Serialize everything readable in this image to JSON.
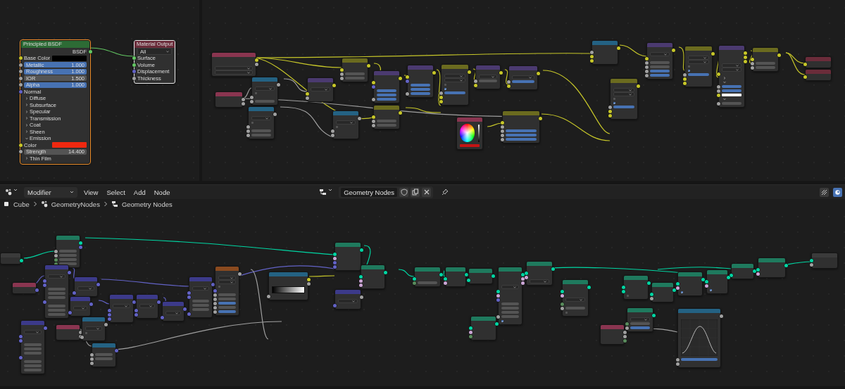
{
  "shader_editor": {
    "nodes": [
      {
        "title": "Principled BSDF",
        "color": "#2d6b35",
        "selected": true,
        "active": false,
        "rows": [
          {
            "kind": "out",
            "label": "BSDF",
            "socket": {
              "color": "#63c763"
            }
          },
          {
            "kind": "color",
            "label": "Base Color",
            "color": "#000000",
            "socket": {
              "color": "#c7c729"
            }
          },
          {
            "kind": "field",
            "label": "Metallic",
            "value": "1.000",
            "filled": true,
            "socket": {
              "color": "#a1a1a1"
            }
          },
          {
            "kind": "field",
            "label": "Roughness",
            "value": "1.000",
            "filled": true,
            "socket": {
              "color": "#a1a1a1"
            }
          },
          {
            "kind": "field",
            "label": "IOR",
            "value": "1.500",
            "filled": false,
            "socket": {
              "color": "#a1a1a1"
            }
          },
          {
            "kind": "field",
            "label": "Alpha",
            "value": "1.000",
            "filled": true,
            "socket": {
              "color": "#a1a1a1"
            }
          },
          {
            "kind": "in",
            "label": "Normal",
            "socket": {
              "color": "#6363c7"
            }
          },
          {
            "kind": "panel",
            "label": "Diffuse",
            "expanded": false
          },
          {
            "kind": "panel",
            "label": "Subsurface",
            "expanded": false
          },
          {
            "kind": "panel",
            "label": "Specular",
            "expanded": false
          },
          {
            "kind": "panel",
            "label": "Transmission",
            "expanded": false
          },
          {
            "kind": "panel",
            "label": "Coat",
            "expanded": false
          },
          {
            "kind": "panel",
            "label": "Sheen",
            "expanded": false
          },
          {
            "kind": "panel",
            "label": "Emission",
            "expanded": true
          },
          {
            "kind": "color",
            "label": "Color",
            "color": "#f02810",
            "socket": {
              "color": "#c7c729"
            }
          },
          {
            "kind": "field",
            "label": "Strength",
            "value": "14.400",
            "filled": false,
            "socket": {
              "color": "#a1a1a1"
            }
          },
          {
            "kind": "panel",
            "label": "Thin Film",
            "expanded": false
          }
        ]
      },
      {
        "title": "Material Output",
        "color": "#6b2c3a",
        "selected": false,
        "active": true,
        "rows": [
          {
            "kind": "dropdown",
            "value": "All"
          },
          {
            "kind": "in",
            "label": "Surface",
            "socket": {
              "color": "#63c763"
            }
          },
          {
            "kind": "in",
            "label": "Volume",
            "socket": {
              "color": "#63c763"
            }
          },
          {
            "kind": "in",
            "label": "Displacement",
            "socket": {
              "color": "#6363c7"
            }
          },
          {
            "kind": "in",
            "label": "Thickness",
            "socket": {
              "color": "#a1a1a1"
            }
          }
        ]
      }
    ]
  },
  "compositor": {
    "nodes": [
      {
        "color": "#8a3550",
        "rows": [
          {
            "kind": "out",
            "socket": {
              "color": "#c7c729"
            }
          },
          {
            "kind": "out",
            "socket": {
              "color": "#a1a1a1"
            }
          },
          {
            "kind": "dropdown"
          },
          {
            "kind": "dropdown"
          }
        ]
      },
      {
        "color": "#8a3550",
        "rows": [
          {
            "kind": "out",
            "socket": {
              "color": "#a1a1a1"
            }
          },
          {
            "kind": "out",
            "socket": {
              "color": "#a1a1a1"
            }
          }
        ]
      },
      {
        "color": "#246283",
        "rows": [
          {
            "kind": "out",
            "socket": {
              "color": "#a1a1a1"
            }
          },
          {
            "kind": "dropdown"
          },
          {
            "kind": "check",
            "checked": false
          },
          {
            "kind": "in",
            "socket": {
              "color": "#a1a1a1"
            }
          },
          {
            "kind": "field",
            "filled": false,
            "socket": {
              "color": "#a1a1a1"
            }
          }
        ]
      },
      {
        "color": "#246283",
        "rows": [
          {
            "kind": "out",
            "socket": {
              "color": "#a1a1a1"
            }
          },
          {
            "kind": "dropdown"
          },
          {
            "kind": "check",
            "checked": false
          },
          {
            "kind": "in",
            "socket": {
              "color": "#a1a1a1"
            }
          },
          {
            "kind": "field",
            "filled": false,
            "socket": {
              "color": "#a1a1a1"
            }
          },
          {
            "kind": "field",
            "filled": false,
            "socket": {
              "color": "#a1a1a1"
            }
          }
        ]
      },
      {
        "color": "#4b3a70",
        "rows": [
          {
            "kind": "out",
            "socket": {
              "color": "#c7c729"
            }
          },
          {
            "kind": "dropdown"
          },
          {
            "kind": "in",
            "socket": {
              "color": "#c7c729"
            }
          },
          {
            "kind": "in",
            "socket": {
              "color": "#a1a1a1"
            }
          }
        ]
      },
      {
        "color": "#6b6b1f",
        "rows": [
          {
            "kind": "out",
            "socket": {
              "color": "#c7c729"
            }
          },
          {
            "kind": "in",
            "socket": {
              "color": "#c7c729"
            }
          },
          {
            "kind": "field",
            "filled": false,
            "socket": {
              "color": "#a1a1a1"
            }
          },
          {
            "kind": "field",
            "filled": false,
            "socket": {
              "color": "#a1a1a1"
            }
          }
        ]
      },
      {
        "color": "#4b3a70",
        "rows": [
          {
            "kind": "out",
            "socket": {
              "color": "#c7c729"
            }
          },
          {
            "kind": "in",
            "socket": {
              "color": "#c7c729"
            }
          },
          {
            "kind": "in",
            "socket": {
              "color": "#6363c7"
            }
          },
          {
            "kind": "field",
            "filled": true
          },
          {
            "kind": "field",
            "filled": true
          },
          {
            "kind": "field",
            "filled": true,
            "socket": {
              "color": "#a1a1a1"
            }
          }
        ]
      },
      {
        "color": "#4b3a70",
        "rows": [
          {
            "kind": "out",
            "socket": {
              "color": "#c7c729"
            }
          },
          {
            "kind": "in",
            "socket": {
              "color": "#c7c729"
            }
          },
          {
            "kind": "in",
            "socket": {
              "color": "#6363c7"
            }
          },
          {
            "kind": "field",
            "filled": true
          },
          {
            "kind": "field",
            "filled": true
          },
          {
            "kind": "field",
            "filled": true,
            "socket": {
              "color": "#a1a1a1"
            }
          }
        ]
      },
      {
        "color": "#6b6b1f",
        "rows": [
          {
            "kind": "out",
            "socket": {
              "color": "#c7c729"
            }
          },
          {
            "kind": "dropdown"
          },
          {
            "kind": "dropdown"
          },
          {
            "kind": "check",
            "checked": false
          },
          {
            "kind": "check",
            "checked": true
          },
          {
            "kind": "field",
            "filled": true,
            "socket": {
              "color": "#a1a1a1"
            }
          },
          {
            "kind": "in",
            "socket": {
              "color": "#c7c729"
            }
          },
          {
            "kind": "in",
            "socket": {
              "color": "#c7c729"
            }
          }
        ]
      },
      {
        "color": "#4b3a70",
        "rows": [
          {
            "kind": "out",
            "socket": {
              "color": "#c7c729"
            }
          },
          {
            "kind": "dropdown"
          },
          {
            "kind": "field",
            "filled": false,
            "socket": {
              "color": "#a1a1a1"
            }
          },
          {
            "kind": "in",
            "socket": {
              "color": "#c7c729"
            }
          }
        ]
      },
      {
        "color": "#4b3a70",
        "rows": [
          {
            "kind": "out",
            "socket": {
              "color": "#c7c729"
            }
          },
          {
            "kind": "dropdown"
          },
          {
            "kind": "field",
            "filled": true,
            "socket": {
              "color": "#a1a1a1"
            }
          },
          {
            "kind": "in",
            "socket": {
              "color": "#c7c729"
            }
          }
        ]
      },
      {
        "color": "#246283",
        "rows": [
          {
            "kind": "out",
            "socket": {
              "color": "#a1a1a1"
            }
          },
          {
            "kind": "dropdown"
          },
          {
            "kind": "check",
            "checked": false
          },
          {
            "kind": "in",
            "socket": {
              "color": "#a1a1a1"
            }
          },
          {
            "kind": "in",
            "socket": {
              "color": "#a1a1a1"
            }
          }
        ]
      },
      {
        "color": "#6b6b1f",
        "rows": [
          {
            "kind": "out",
            "socket": {
              "color": "#c7c729"
            }
          },
          {
            "kind": "in",
            "socket": {
              "color": "#c7c729"
            }
          },
          {
            "kind": "field",
            "filled": false,
            "socket": {
              "color": "#a1a1a1"
            }
          },
          {
            "kind": "field",
            "filled": false,
            "socket": {
              "color": "#a1a1a1"
            }
          }
        ]
      },
      {
        "color": "#8a3550",
        "rows": [
          {
            "kind": "wheel"
          },
          {
            "kind": "color",
            "color": "#c41414"
          }
        ]
      },
      {
        "color": "#6b6b1f",
        "rows": [
          {
            "kind": "out",
            "socket": {
              "color": "#c7c729"
            }
          },
          {
            "kind": "in",
            "socket": {
              "color": "#c7c729"
            }
          },
          {
            "kind": "in",
            "socket": {
              "color": "#a1a1a1"
            }
          },
          {
            "kind": "field",
            "filled": true,
            "socket": {
              "color": "#a1a1a1"
            }
          },
          {
            "kind": "field",
            "filled": true,
            "socket": {
              "color": "#a1a1a1"
            }
          },
          {
            "kind": "field",
            "filled": true,
            "socket": {
              "color": "#a1a1a1"
            }
          }
        ]
      },
      {
        "color": "#246283",
        "rows": [
          {
            "kind": "out",
            "socket": {
              "color": "#c7c729"
            }
          },
          {
            "kind": "in",
            "socket": {
              "color": "#a1a1a1"
            }
          },
          {
            "kind": "in",
            "socket": {
              "color": "#c7c729"
            }
          },
          {
            "kind": "in",
            "socket": {
              "color": "#c7c729"
            }
          }
        ]
      },
      {
        "color": "#6b6b1f",
        "rows": [
          {
            "kind": "out",
            "socket": {
              "color": "#c7c729"
            }
          },
          {
            "kind": "dropdown"
          },
          {
            "kind": "dropdown"
          },
          {
            "kind": "check",
            "checked": false
          },
          {
            "kind": "check",
            "checked": true
          },
          {
            "kind": "field",
            "filled": true,
            "socket": {
              "color": "#a1a1a1"
            }
          },
          {
            "kind": "in",
            "socket": {
              "color": "#c7c729"
            }
          },
          {
            "kind": "in",
            "socket": {
              "color": "#c7c729"
            }
          }
        ]
      },
      {
        "color": "#4b3a70",
        "rows": [
          {
            "kind": "out",
            "socket": {
              "color": "#c7c729"
            }
          },
          {
            "kind": "dropdown"
          },
          {
            "kind": "in",
            "socket": {
              "color": "#c7c729"
            }
          },
          {
            "kind": "field",
            "filled": false,
            "socket": {
              "color": "#a1a1a1"
            }
          },
          {
            "kind": "field",
            "filled": false,
            "socket": {
              "color": "#a1a1a1"
            }
          },
          {
            "kind": "field",
            "filled": true,
            "socket": {
              "color": "#a1a1a1"
            }
          },
          {
            "kind": "field",
            "filled": true,
            "socket": {
              "color": "#a1a1a1"
            }
          }
        ]
      },
      {
        "color": "#6b6b1f",
        "rows": [
          {
            "kind": "out",
            "socket": {
              "color": "#c7c729"
            }
          },
          {
            "kind": "dropdown"
          },
          {
            "kind": "dropdown"
          },
          {
            "kind": "check",
            "checked": false
          },
          {
            "kind": "check",
            "checked": true
          },
          {
            "kind": "field",
            "filled": true,
            "socket": {
              "color": "#a1a1a1"
            }
          },
          {
            "kind": "in",
            "socket": {
              "color": "#c7c729"
            }
          },
          {
            "kind": "in",
            "socket": {
              "color": "#c7c729"
            }
          }
        ]
      },
      {
        "color": "#4b3a70",
        "rows": [
          {
            "kind": "out",
            "socket": {
              "color": "#c7c729"
            }
          },
          {
            "kind": "out",
            "socket": {
              "color": "#c7c729"
            }
          },
          {
            "kind": "out",
            "socket": {
              "color": "#c7c729"
            }
          },
          {
            "kind": "dropdown"
          },
          {
            "kind": "dropdown"
          },
          {
            "kind": "in",
            "socket": {
              "color": "#c7c729"
            }
          },
          {
            "kind": "panel",
            "expanded": false
          },
          {
            "kind": "panel",
            "expanded": true
          },
          {
            "kind": "field",
            "filled": true,
            "socket": {
              "color": "#a1a1a1"
            }
          },
          {
            "kind": "field",
            "filled": true,
            "socket": {
              "color": "#a1a1a1"
            }
          },
          {
            "kind": "color",
            "color": "#ffffff",
            "socket": {
              "color": "#c7c729"
            }
          },
          {
            "kind": "panel",
            "expanded": true
          },
          {
            "kind": "field",
            "filled": false,
            "socket": {
              "color": "#a1a1a1"
            }
          }
        ]
      },
      {
        "color": "#6b6b1f",
        "rows": [
          {
            "kind": "out",
            "socket": {
              "color": "#c7c729"
            }
          },
          {
            "kind": "in",
            "socket": {
              "color": "#c7c729"
            }
          },
          {
            "kind": "field",
            "filled": false,
            "socket": {
              "color": "#a1a1a1"
            }
          },
          {
            "kind": "field",
            "filled": false,
            "socket": {
              "color": "#a1a1a1"
            }
          }
        ]
      },
      {
        "color": "#6b2c3a",
        "rows": [
          {
            "kind": "in",
            "socket": {
              "color": "#c7c729"
            }
          }
        ]
      },
      {
        "color": "#6b2c3a",
        "rows": [
          {
            "kind": "in",
            "socket": {
              "color": "#c7c729"
            }
          }
        ]
      }
    ]
  },
  "geometry_editor": {
    "header": {
      "editor_menu": "Modifier",
      "menus": [
        "View",
        "Select",
        "Add",
        "Node"
      ],
      "node_group": "Geometry Nodes"
    },
    "breadcrumbs": [
      "Cube",
      "GeometryNodes",
      "Geometry Nodes"
    ],
    "nodes": [
      {
        "color": "#3b3b3b",
        "rows": [
          {
            "kind": "out",
            "socket": {
              "color": "#00d6a3"
            }
          }
        ]
      },
      {
        "color": "#1f7a5e",
        "rows": [
          {
            "kind": "out",
            "socket": {
              "color": "#00d6a3"
            }
          },
          {
            "kind": "out",
            "socket": {
              "color": "#6363c7"
            }
          },
          {
            "kind": "field",
            "filled": false,
            "socket": {
              "color": "#a1a1a1"
            }
          },
          {
            "kind": "field",
            "filled": false,
            "socket": {
              "color": "#a1a1a1"
            }
          },
          {
            "kind": "field",
            "filled": false,
            "socket": {
              "color": "#598c5c"
            }
          },
          {
            "kind": "field",
            "filled": false,
            "socket": {
              "color": "#598c5c"
            }
          }
        ]
      },
      {
        "color": "#8a3550",
        "rows": [
          {
            "kind": "out",
            "socket": {
              "color": "#6363c7"
            }
          }
        ]
      },
      {
        "color": "#3c3a8a",
        "rows": [
          {
            "kind": "out",
            "socket": {
              "color": "#6363c7"
            }
          },
          {
            "kind": "dropdown"
          },
          {
            "kind": "in",
            "socket": {
              "color": "#6363c7"
            }
          },
          {
            "kind": "in",
            "socket": {
              "color": "#6363c7"
            }
          },
          {
            "kind": "field",
            "filled": false
          },
          {
            "kind": "field",
            "filled": false
          },
          {
            "kind": "field",
            "filled": false
          },
          {
            "kind": "in",
            "socket": {
              "color": "#6363c7"
            }
          },
          {
            "kind": "field",
            "filled": false
          },
          {
            "kind": "field",
            "filled": false
          },
          {
            "kind": "field",
            "filled": false
          }
        ]
      },
      {
        "color": "#3c3a8a",
        "rows": [
          {
            "kind": "out",
            "socket": {
              "color": "#6363c7"
            }
          },
          {
            "kind": "dropdown"
          },
          {
            "kind": "in",
            "socket": {
              "color": "#6363c7"
            }
          },
          {
            "kind": "in",
            "socket": {
              "color": "#6363c7"
            }
          },
          {
            "kind": "field",
            "filled": false
          },
          {
            "kind": "field",
            "filled": false
          },
          {
            "kind": "field",
            "filled": false
          },
          {
            "kind": "in",
            "socket": {
              "color": "#6363c7"
            }
          },
          {
            "kind": "field",
            "filled": false
          },
          {
            "kind": "field",
            "filled": false
          },
          {
            "kind": "field",
            "filled": false
          }
        ]
      },
      {
        "color": "#3c3a8a",
        "rows": [
          {
            "kind": "out",
            "socket": {
              "color": "#6363c7"
            }
          },
          {
            "kind": "dropdown"
          },
          {
            "kind": "in",
            "socket": {
              "color": "#6363c7"
            }
          }
        ]
      },
      {
        "color": "#3c3a8a",
        "rows": [
          {
            "kind": "out",
            "socket": {
              "color": "#6363c7"
            }
          },
          {
            "kind": "dropdown"
          },
          {
            "kind": "in",
            "socket": {
              "color": "#6363c7"
            }
          }
        ]
      },
      {
        "color": "#3c3a8a",
        "rows": [
          {
            "kind": "out",
            "socket": {
              "color": "#6363c7"
            }
          },
          {
            "kind": "dropdown"
          },
          {
            "kind": "in",
            "socket": {
              "color": "#6363c7"
            }
          },
          {
            "kind": "in",
            "socket": {
              "color": "#6363c7"
            }
          },
          {
            "kind": "in",
            "socket": {
              "color": "#6363c7"
            }
          }
        ]
      },
      {
        "color": "#3c3a8a",
        "rows": [
          {
            "kind": "out",
            "socket": {
              "color": "#6363c7"
            }
          },
          {
            "kind": "dropdown"
          },
          {
            "kind": "in",
            "socket": {
              "color": "#6363c7"
            }
          },
          {
            "kind": "in",
            "socket": {
              "color": "#6363c7"
            }
          }
        ]
      },
      {
        "color": "#3c3a8a",
        "rows": [
          {
            "kind": "out",
            "socket": {
              "color": "#6363c7"
            }
          },
          {
            "kind": "dropdown"
          },
          {
            "kind": "in",
            "socket": {
              "color": "#6363c7"
            }
          }
        ]
      },
      {
        "color": "#3c3a8a",
        "rows": [
          {
            "kind": "out",
            "socket": {
              "color": "#6363c7"
            }
          },
          {
            "kind": "dropdown"
          },
          {
            "kind": "in",
            "socket": {
              "color": "#6363c7"
            }
          },
          {
            "kind": "in",
            "socket": {
              "color": "#6363c7"
            }
          },
          {
            "kind": "field",
            "filled": false
          },
          {
            "kind": "field",
            "filled": false
          },
          {
            "kind": "field",
            "filled": false
          },
          {
            "kind": "in",
            "socket": {
              "color": "#6363c7"
            }
          }
        ]
      },
      {
        "color": "#8a4a1f",
        "rows": [
          {
            "kind": "out",
            "socket": {
              "color": "#a1a1a1"
            }
          },
          {
            "kind": "dropdown"
          },
          {
            "kind": "dropdown"
          },
          {
            "kind": "check",
            "checked": false
          },
          {
            "kind": "in",
            "socket": {
              "color": "#6363c7"
            }
          },
          {
            "kind": "field",
            "filled": false,
            "socket": {
              "color": "#a1a1a1"
            }
          },
          {
            "kind": "field",
            "filled": false,
            "socket": {
              "color": "#a1a1a1"
            }
          },
          {
            "kind": "field",
            "filled": true,
            "socket": {
              "color": "#a1a1a1"
            }
          },
          {
            "kind": "field",
            "filled": false,
            "socket": {
              "color": "#a1a1a1"
            }
          },
          {
            "kind": "field",
            "filled": true,
            "socket": {
              "color": "#a1a1a1"
            }
          }
        ]
      },
      {
        "color": "#8a3550",
        "rows": [
          {
            "kind": "out",
            "socket": {
              "color": "#a1a1a1"
            }
          },
          {
            "kind": "out",
            "socket": {
              "color": "#a1a1a1"
            }
          }
        ]
      },
      {
        "color": "#246283",
        "rows": [
          {
            "kind": "out",
            "socket": {
              "color": "#a1a1a1"
            }
          },
          {
            "kind": "dropdown"
          },
          {
            "kind": "check",
            "checked": false
          },
          {
            "kind": "in",
            "socket": {
              "color": "#a1a1a1"
            }
          }
        ]
      },
      {
        "color": "#246283",
        "rows": [
          {
            "kind": "out",
            "socket": {
              "color": "#6363c7"
            }
          },
          {
            "kind": "field",
            "filled": false,
            "socket": {
              "color": "#a1a1a1"
            }
          },
          {
            "kind": "field",
            "filled": false,
            "socket": {
              "color": "#a1a1a1"
            }
          },
          {
            "kind": "in",
            "socket": {
              "color": "#a1a1a1"
            }
          }
        ]
      },
      {
        "color": "#246283",
        "rows": [
          {
            "kind": "out",
            "socket": {
              "color": "#c7c729"
            }
          },
          {
            "kind": "out",
            "socket": {
              "color": "#a1a1a1"
            }
          },
          {
            "kind": "ramp"
          },
          {
            "kind": "in",
            "socket": {
              "color": "#a1a1a1"
            }
          }
        ]
      },
      {
        "color": "#1f7a5e",
        "rows": [
          {
            "kind": "out",
            "socket": {
              "color": "#00d6a3"
            }
          },
          {
            "kind": "in",
            "socket": {
              "color": "#00d6a3"
            }
          },
          {
            "kind": "in",
            "socket": {
              "color": "#cca6d6"
            }
          },
          {
            "kind": "in",
            "socket": {
              "color": "#6363c7"
            }
          },
          {
            "kind": "in",
            "socket": {
              "color": "#6363c7"
            }
          }
        ]
      },
      {
        "color": "#3c3a8a",
        "rows": [
          {
            "kind": "out",
            "socket": {
              "color": "#a1a1a1"
            }
          },
          {
            "kind": "dropdown"
          },
          {
            "kind": "in",
            "socket": {
              "color": "#6363c7"
            }
          }
        ]
      },
      {
        "color": "#1f7a5e",
        "rows": [
          {
            "kind": "out",
            "socket": {
              "color": "#00d6a3"
            }
          },
          {
            "kind": "in",
            "socket": {
              "color": "#00d6a3"
            }
          },
          {
            "kind": "in",
            "socket": {
              "color": "#cca6d6"
            }
          },
          {
            "kind": "in",
            "socket": {
              "color": "#cca6d6"
            }
          }
        ]
      },
      {
        "color": "#1f7a5e",
        "rows": [
          {
            "kind": "out",
            "socket": {
              "color": "#00d6a3"
            }
          },
          {
            "kind": "in",
            "socket": {
              "color": "#00d6a3"
            }
          },
          {
            "kind": "field",
            "filled": false,
            "socket": {
              "color": "#598c5c"
            }
          }
        ]
      },
      {
        "color": "#1f7a5e",
        "rows": [
          {
            "kind": "out",
            "socket": {
              "color": "#00d6a3"
            }
          },
          {
            "kind": "in",
            "socket": {
              "color": "#00d6a3"
            }
          },
          {
            "kind": "in",
            "socket": {
              "color": "#cca6d6"
            }
          }
        ]
      },
      {
        "color": "#1f7a5e",
        "rows": [
          {
            "kind": "out",
            "socket": {
              "color": "#00d6a3"
            }
          },
          {
            "kind": "in",
            "socket": {
              "color": "#00d6a3"
            }
          }
        ]
      },
      {
        "color": "#1f7a5e",
        "rows": [
          {
            "kind": "out",
            "socket": {
              "color": "#00d6a3"
            }
          },
          {
            "kind": "out",
            "socket": {
              "color": "#cca6d6"
            }
          },
          {
            "kind": "out",
            "socket": {
              "color": "#cca6d6"
            }
          },
          {
            "kind": "dropdown"
          },
          {
            "kind": "in",
            "socket": {
              "color": "#00d6a3"
            }
          },
          {
            "kind": "in",
            "socket": {
              "color": "#cca6d6"
            }
          },
          {
            "kind": "in",
            "socket": {
              "color": "#6363c7"
            }
          },
          {
            "kind": "field",
            "filled": false
          },
          {
            "kind": "field",
            "filled": false
          },
          {
            "kind": "field",
            "filled": false
          },
          {
            "kind": "field",
            "filled": false,
            "socket": {
              "color": "#a1a1a1"
            }
          },
          {
            "kind": "check",
            "checked": true
          }
        ]
      },
      {
        "color": "#1f7a5e",
        "rows": [
          {
            "kind": "out",
            "socket": {
              "color": "#00d6a3"
            }
          },
          {
            "kind": "in",
            "socket": {
              "color": "#00d6a3"
            }
          },
          {
            "kind": "in",
            "socket": {
              "color": "#cca6d6"
            }
          },
          {
            "kind": "in",
            "socket": {
              "color": "#598c5c"
            }
          }
        ]
      },
      {
        "color": "#1f7a5e",
        "rows": [
          {
            "kind": "out",
            "socket": {
              "color": "#00d6a3"
            }
          },
          {
            "kind": "in",
            "socket": {
              "color": "#00d6a3"
            }
          },
          {
            "kind": "in",
            "socket": {
              "color": "#cca6d6"
            }
          },
          {
            "kind": "dropdown"
          }
        ]
      },
      {
        "color": "#1f7a5e",
        "rows": [
          {
            "kind": "out",
            "socket": {
              "color": "#00d6a3"
            }
          },
          {
            "kind": "in",
            "socket": {
              "color": "#00d6a3"
            }
          },
          {
            "kind": "in",
            "socket": {
              "color": "#cca6d6"
            }
          },
          {
            "kind": "dropdown"
          },
          {
            "kind": "in",
            "socket": {
              "color": "#598c5c"
            }
          },
          {
            "kind": "field",
            "filled": false,
            "socket": {
              "color": "#a1a1a1"
            }
          },
          {
            "kind": "check",
            "checked": false
          }
        ]
      },
      {
        "color": "#8a3550",
        "rows": [
          {
            "kind": "out",
            "socket": {
              "color": "#a1a1a1"
            }
          },
          {
            "kind": "out",
            "socket": {
              "color": "#a1a1a1"
            }
          },
          {
            "kind": "out",
            "socket": {
              "color": "#598c5c"
            }
          }
        ]
      },
      {
        "color": "#1f7a5e",
        "rows": [
          {
            "kind": "out",
            "socket": {
              "color": "#00d6a3"
            }
          },
          {
            "kind": "in",
            "socket": {
              "color": "#00d6a3"
            }
          },
          {
            "kind": "in",
            "socket": {
              "color": "#00d6a3"
            }
          },
          {
            "kind": "check",
            "checked": false
          }
        ]
      },
      {
        "color": "#1f7a5e",
        "rows": [
          {
            "kind": "out",
            "socket": {
              "color": "#00d6a3"
            }
          },
          {
            "kind": "in",
            "socket": {
              "color": "#00d6a3"
            }
          },
          {
            "kind": "in",
            "socket": {
              "color": "#a1a1a1"
            }
          }
        ]
      },
      {
        "color": "#1f7a5e",
        "rows": [
          {
            "kind": "out",
            "socket": {
              "color": "#00d6a3"
            }
          },
          {
            "kind": "dropdown"
          },
          {
            "kind": "field",
            "filled": false,
            "socket": {
              "color": "#598c5c"
            }
          },
          {
            "kind": "field",
            "filled": true,
            "socket": {
              "color": "#a1a1a1"
            }
          }
        ]
      },
      {
        "color": "#246283",
        "rows": [
          {
            "kind": "out",
            "socket": {
              "color": "#a1a1a1"
            }
          },
          {
            "kind": "curve"
          },
          {
            "kind": "field",
            "filled": true,
            "socket": {
              "color": "#a1a1a1"
            }
          },
          {
            "kind": "in",
            "socket": {
              "color": "#a1a1a1"
            }
          }
        ]
      },
      {
        "color": "#1f7a5e",
        "rows": [
          {
            "kind": "out",
            "socket": {
              "color": "#00d6a3"
            }
          },
          {
            "kind": "in",
            "socket": {
              "color": "#00d6a3"
            }
          },
          {
            "kind": "in",
            "socket": {
              "color": "#cca6d6"
            }
          },
          {
            "kind": "check",
            "checked": true
          }
        ]
      },
      {
        "color": "#1f7a5e",
        "rows": [
          {
            "kind": "out",
            "socket": {
              "color": "#00d6a3"
            }
          },
          {
            "kind": "in",
            "socket": {
              "color": "#00d6a3"
            }
          }
        ]
      },
      {
        "color": "#1f7a5e",
        "rows": [
          {
            "kind": "out",
            "socket": {
              "color": "#00d6a3"
            }
          },
          {
            "kind": "in",
            "socket": {
              "color": "#00d6a3"
            }
          },
          {
            "kind": "in",
            "socket": {
              "color": "#cca6d6"
            }
          },
          {
            "kind": "check",
            "checked": true
          }
        ]
      },
      {
        "color": "#1f7a5e",
        "rows": [
          {
            "kind": "out",
            "socket": {
              "color": "#00d6a3"
            }
          },
          {
            "kind": "in",
            "socket": {
              "color": "#00d6a3"
            }
          },
          {
            "kind": "in",
            "socket": {
              "color": "#cca6d6"
            }
          }
        ]
      },
      {
        "color": "#3b3b3b",
        "rows": [
          {
            "kind": "in",
            "socket": {
              "color": "#00d6a3"
            }
          },
          {
            "kind": "in",
            "socket": {
              "color": "#a1a1a1"
            }
          }
        ]
      }
    ]
  }
}
